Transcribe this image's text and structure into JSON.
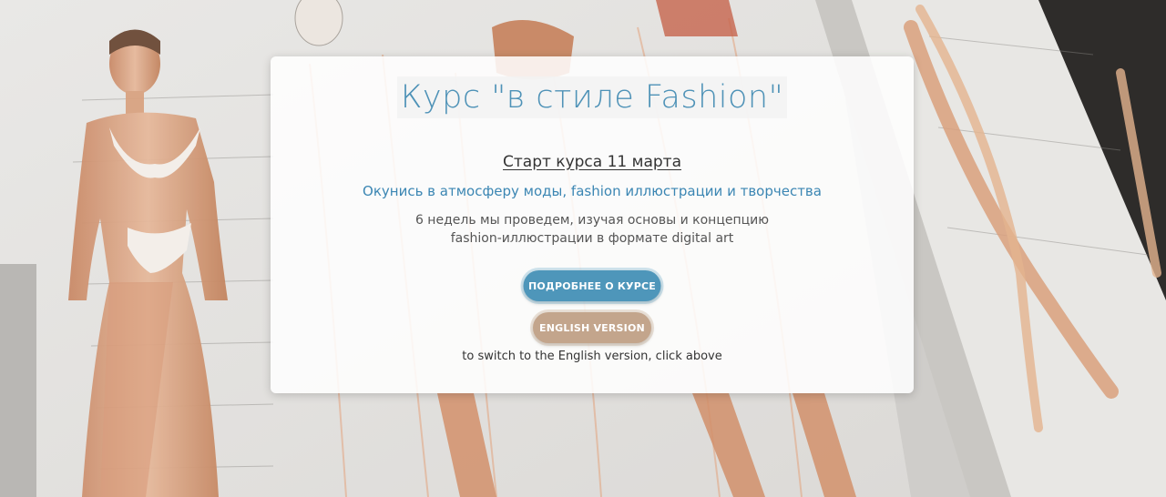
{
  "card": {
    "title": "Курс \"в стиле Fashion\"",
    "start_link": "Старт курса 11 марта",
    "tagline": "Окунись в атмосферу моды, fashion иллюстрации и творчества",
    "description_line1": "6 недель мы проведем, изучая основы и концепцию",
    "description_line2": "fashion-иллюстрации в формате digital art",
    "more_button": "ПОДРОБНЕЕ О КУРСЕ",
    "english_button": "ENGLISH VERSION",
    "switch_note": "to switch to the English version, click above"
  },
  "colors": {
    "accent_blue": "#4e96ba",
    "accent_beige": "#c3a58c",
    "title_blue": "#4e92b7"
  },
  "background": {
    "icon": "fashion-sketch-tablet-illustration"
  }
}
